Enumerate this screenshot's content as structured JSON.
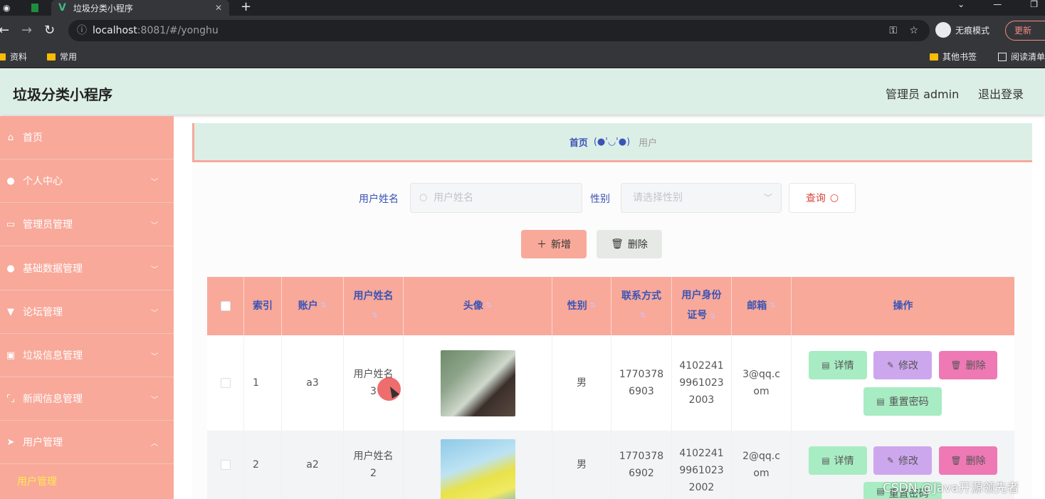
{
  "browser": {
    "tab_title": "垃圾分类小程序",
    "url_host": "localhost",
    "url_rest": ":8081/#/yonghu",
    "incognito_label": "无痕模式",
    "update_label": "更新",
    "bookmarks": [
      "资料",
      "常用"
    ],
    "bookmarks_right": [
      "其他书签",
      "阅读清单"
    ]
  },
  "header": {
    "title": "垃圾分类小程序",
    "admin_label": "管理员 admin",
    "logout_label": "退出登录"
  },
  "sidebar": {
    "items": [
      {
        "label": "首页",
        "icon": "home-icon"
      },
      {
        "label": "个人中心",
        "icon": "user-icon"
      },
      {
        "label": "管理员管理",
        "icon": "chart-icon"
      },
      {
        "label": "基础数据管理",
        "icon": "person-icon"
      },
      {
        "label": "论坛管理",
        "icon": "flag-icon"
      },
      {
        "label": "垃圾信息管理",
        "icon": "trash-icon"
      },
      {
        "label": "新闻信息管理",
        "icon": "frame-icon"
      },
      {
        "label": "用户管理",
        "icon": "send-icon"
      }
    ],
    "active_sub": "用户管理"
  },
  "breadcrumb": {
    "home": "首页",
    "emoji": "(●'◡'●)",
    "current": "用户"
  },
  "search": {
    "name_label": "用户姓名",
    "name_placeholder": "用户姓名",
    "gender_label": "性别",
    "gender_placeholder": "请选择性别",
    "query_label": "查询"
  },
  "actions": {
    "add_label": "新增",
    "delete_label": "删除"
  },
  "table": {
    "headers": {
      "index": "索引",
      "account": "账户",
      "name_l1": "用户姓名",
      "avatar": "头像",
      "gender": "性别",
      "phone": "联系方式",
      "idcard_l1": "用户身份",
      "idcard_l2": "证号",
      "email": "邮箱",
      "ops": "操作"
    },
    "rows": [
      {
        "index": "1",
        "account": "a3",
        "name_l1": "用户姓名",
        "name_l2": "3",
        "gender": "男",
        "phone_l1": "1770378",
        "phone_l2": "6903",
        "id_l1": "4102241",
        "id_l2": "9961023",
        "id_l3": "2003",
        "email_l1": "3@qq.c",
        "email_l2": "om"
      },
      {
        "index": "2",
        "account": "a2",
        "name_l1": "用户姓名",
        "name_l2": "2",
        "gender": "男",
        "phone_l1": "1770378",
        "phone_l2": "6902",
        "id_l1": "4102241",
        "id_l2": "9961023",
        "id_l3": "2002",
        "email_l1": "2@qq.c",
        "email_l2": "om"
      }
    ],
    "row_actions": {
      "detail": "详情",
      "edit": "修改",
      "delete": "删除",
      "reset": "重置密码"
    }
  },
  "watermark": "CSDN @Java开源领先者"
}
